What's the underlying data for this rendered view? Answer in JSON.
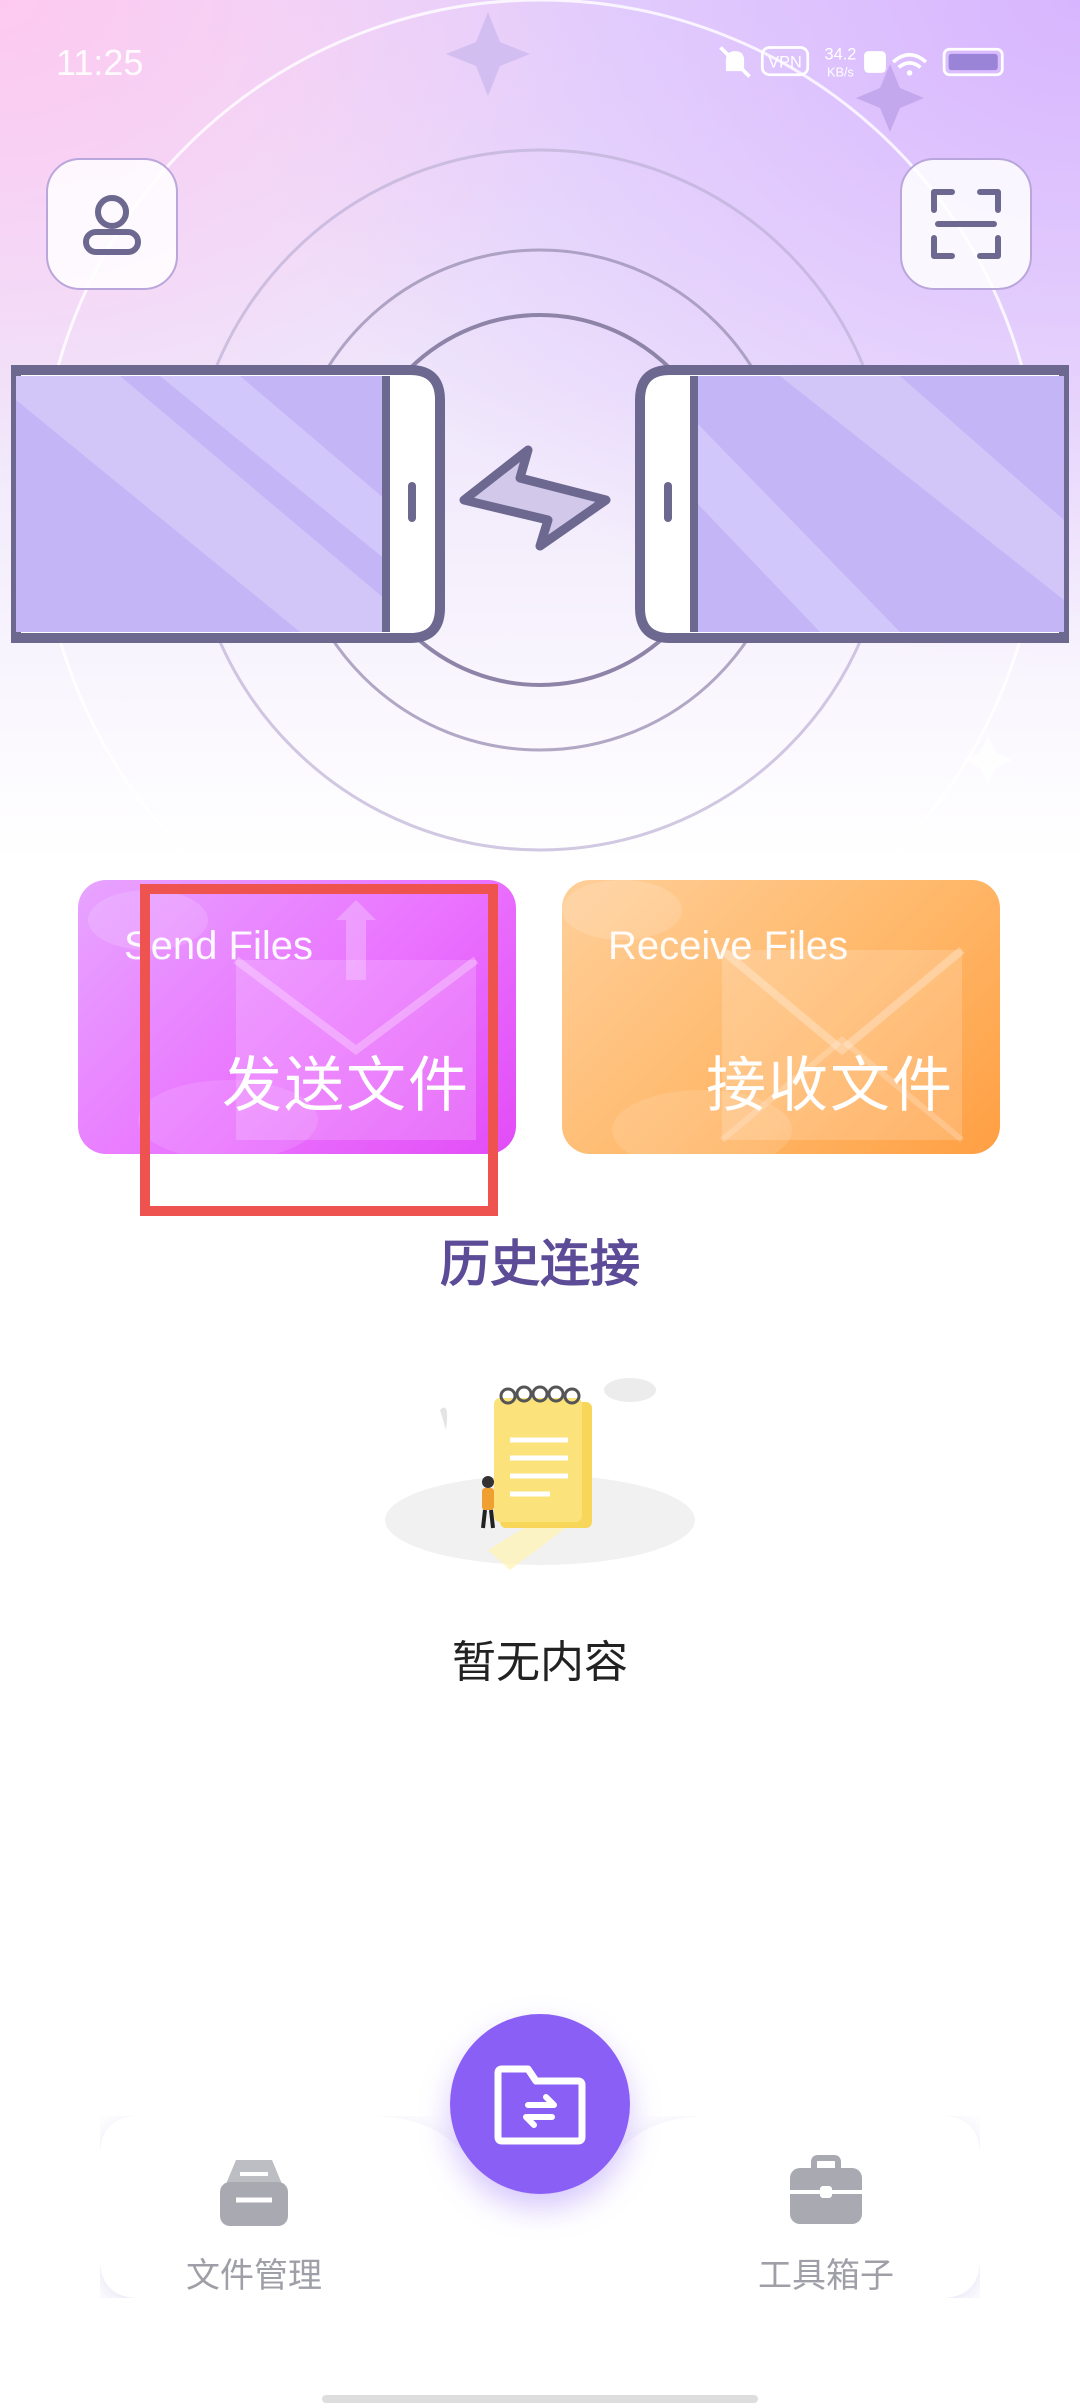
{
  "status_bar": {
    "time": "11:25",
    "vpn_label": "VPN",
    "speed_value": "34.2",
    "speed_unit": "KB/s"
  },
  "header": {
    "profile_icon": "profile-icon",
    "scan_icon": "scan-icon"
  },
  "actions": {
    "send": {
      "label_en": "Send Files",
      "label_zh": "发送文件"
    },
    "receive": {
      "label_en": "Receive Files",
      "label_zh": "接收文件"
    }
  },
  "history": {
    "title": "历史连接",
    "empty_text": "暂无内容"
  },
  "bottom_nav": {
    "left_label": "文件管理",
    "right_label": "工具箱子"
  },
  "colors": {
    "accent_purple": "#8a5ff5",
    "send_card": "#ea73ff",
    "receive_card": "#ffb86a",
    "highlight_box": "#ef5350",
    "history_title": "#5c4b96"
  }
}
